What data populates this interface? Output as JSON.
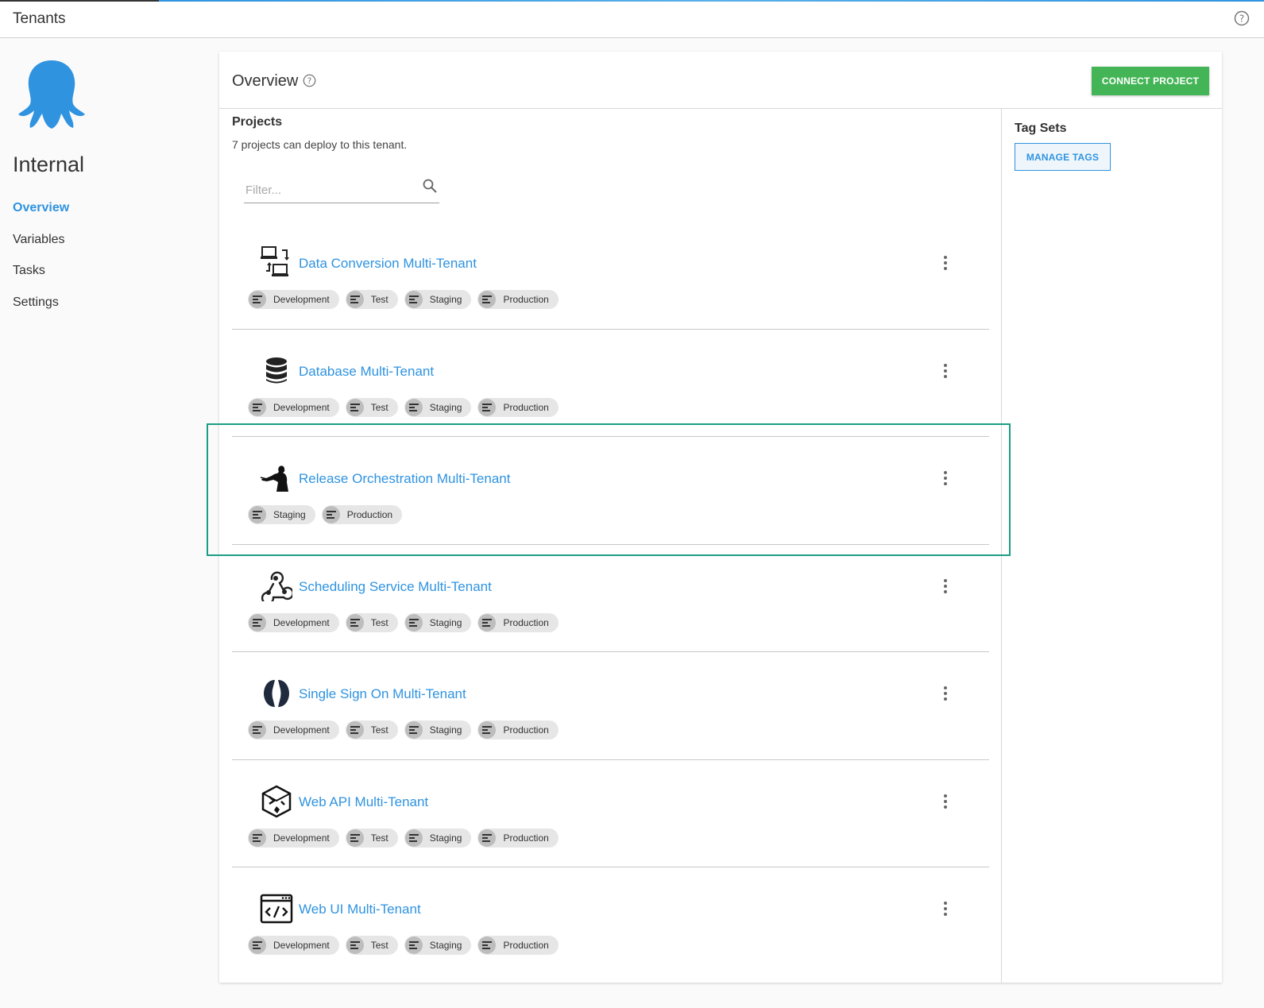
{
  "topbar": {
    "title": "Tenants"
  },
  "sidebar": {
    "tenant_name": "Internal",
    "nav": [
      {
        "label": "Overview",
        "active": true
      },
      {
        "label": "Variables",
        "active": false
      },
      {
        "label": "Tasks",
        "active": false
      },
      {
        "label": "Settings",
        "active": false
      }
    ]
  },
  "overview": {
    "title": "Overview",
    "connect_label": "CONNECT PROJECT",
    "projects_heading": "Projects",
    "projects_subtitle": "7 projects can deploy to this tenant.",
    "filter_placeholder": "Filter...",
    "tag_sets_title": "Tag Sets",
    "manage_tags_label": "MANAGE TAGS"
  },
  "projects": [
    {
      "name": "Data Conversion Multi-Tenant",
      "icon": "data-conversion-icon",
      "environments": [
        "Development",
        "Test",
        "Staging",
        "Production"
      ]
    },
    {
      "name": "Database Multi-Tenant",
      "icon": "database-icon",
      "environments": [
        "Development",
        "Test",
        "Staging",
        "Production"
      ]
    },
    {
      "name": "Release Orchestration Multi-Tenant",
      "icon": "conductor-icon",
      "environments": [
        "Staging",
        "Production"
      ],
      "highlighted": true
    },
    {
      "name": "Scheduling Service Multi-Tenant",
      "icon": "webhook-icon",
      "environments": [
        "Development",
        "Test",
        "Staging",
        "Production"
      ]
    },
    {
      "name": "Single Sign On Multi-Tenant",
      "icon": "single-sign-on-icon",
      "environments": [
        "Development",
        "Test",
        "Staging",
        "Production"
      ]
    },
    {
      "name": "Web API Multi-Tenant",
      "icon": "web-api-icon",
      "environments": [
        "Development",
        "Test",
        "Staging",
        "Production"
      ]
    },
    {
      "name": "Web UI Multi-Tenant",
      "icon": "code-window-icon",
      "environments": [
        "Development",
        "Test",
        "Staging",
        "Production"
      ]
    }
  ],
  "colors": {
    "accent": "#2f93e0",
    "primary_button": "#44b556",
    "highlight_border": "#1b9e83"
  }
}
